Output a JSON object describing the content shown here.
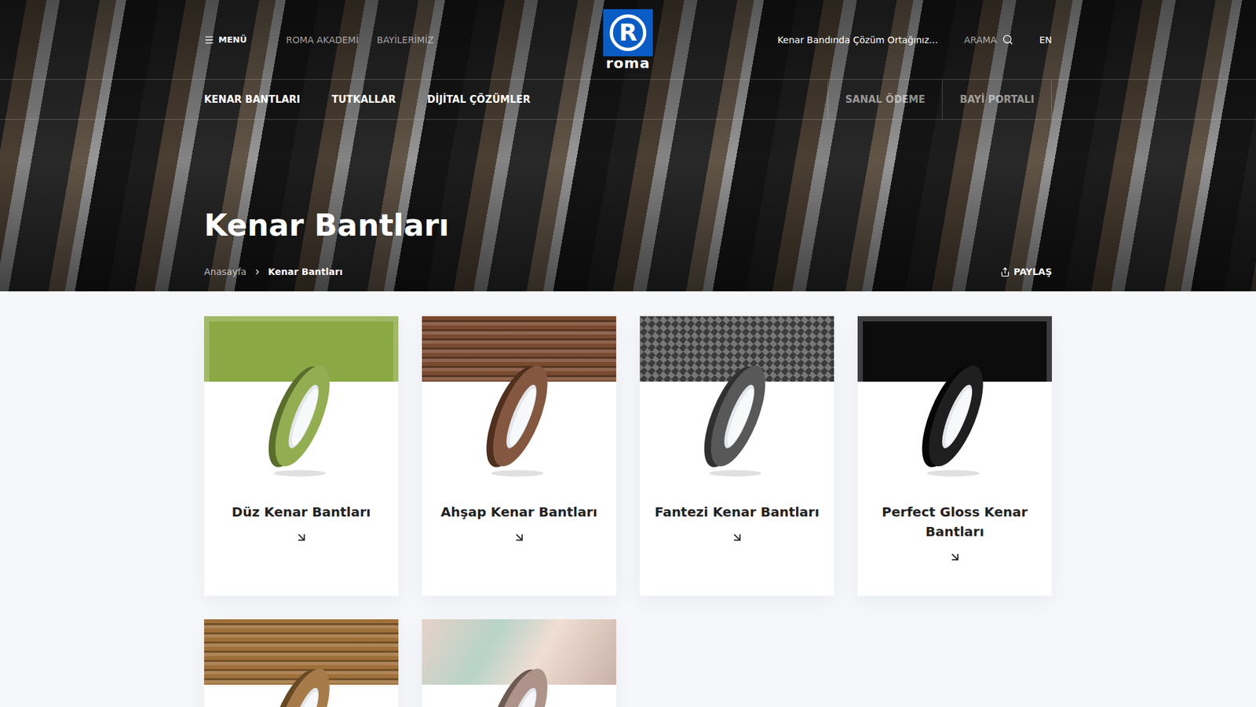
{
  "header": {
    "menu_label": "MENÜ",
    "links": [
      "ROMA AKADEMİ",
      "BAYİLERİMİZ"
    ],
    "logo": {
      "letter": "R",
      "name": "roma"
    },
    "tagline": "Kenar Bandında Çözüm Ortağınız...",
    "search_label": "ARAMA",
    "language": "EN"
  },
  "nav": {
    "items": [
      "KENAR BANTLARI",
      "TUTKALLAR",
      "DİJİTAL ÇÖZÜMLER"
    ],
    "utility": [
      "SANAL ÖDEME",
      "BAYİ PORTALI"
    ]
  },
  "page": {
    "title": "Kenar Bantları",
    "breadcrumb": [
      "Anasayfa",
      "Kenar Bantları"
    ],
    "share_label": "PAYLAŞ"
  },
  "cards": [
    {
      "title": "Düz Kenar Bantları",
      "kind": "solid",
      "color": "#8aa844"
    },
    {
      "title": "Ahşap Kenar Bantları",
      "kind": "wood",
      "color": "#7a4a30"
    },
    {
      "title": "Fantezi Kenar Bantları",
      "kind": "carbon",
      "color": "#555555"
    },
    {
      "title": "Perfect Gloss Kenar Bantları",
      "kind": "solid",
      "color": "#0c0c0c"
    },
    {
      "kind": "wood",
      "color": "#a0703a"
    },
    {
      "kind": "marble",
      "color": "#a88a80"
    }
  ]
}
